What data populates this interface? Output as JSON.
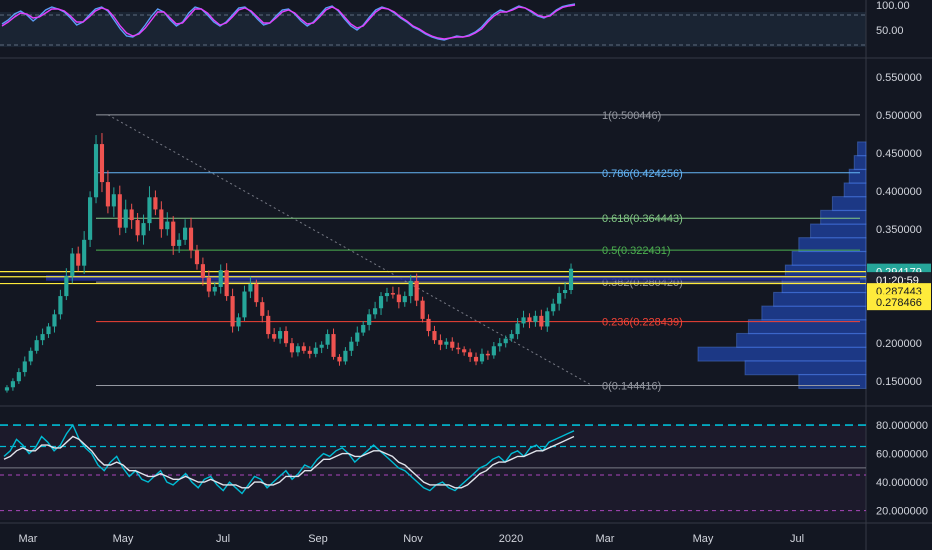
{
  "chart_data": [
    {
      "type": "line",
      "panel": "stochastic-rsi",
      "y_ticks": [
        "100.00",
        "50.00"
      ],
      "ylim": [
        0,
        110
      ],
      "series": [
        {
          "color": "#5b9cf6",
          "values": [
            62,
            70,
            82,
            88,
            80,
            68,
            78,
            90,
            96,
            92,
            86,
            74,
            60,
            66,
            80,
            92,
            96,
            88,
            70,
            52,
            38,
            36,
            44,
            60,
            78,
            92,
            86,
            70,
            58,
            66,
            84,
            96,
            92,
            80,
            66,
            58,
            66,
            80,
            94,
            96,
            86,
            72,
            60,
            64,
            78,
            90,
            92,
            82,
            68,
            58,
            66,
            80,
            94,
            98,
            88,
            72,
            58,
            50,
            60,
            76,
            90,
            96,
            92,
            84,
            74,
            66,
            56,
            50,
            42,
            36,
            32,
            30,
            34,
            38,
            36,
            40,
            46,
            56,
            70,
            82,
            90,
            86,
            92,
            98,
            94,
            86,
            78,
            74,
            80,
            90,
            97,
            100,
            102
          ]
        },
        {
          "color": "#e040fb",
          "values": [
            58,
            66,
            76,
            84,
            82,
            74,
            76,
            84,
            92,
            92,
            88,
            78,
            66,
            66,
            76,
            88,
            94,
            90,
            76,
            58,
            44,
            38,
            42,
            54,
            70,
            86,
            86,
            74,
            62,
            64,
            78,
            92,
            92,
            84,
            70,
            60,
            64,
            76,
            90,
            94,
            88,
            76,
            64,
            64,
            74,
            86,
            90,
            84,
            72,
            62,
            64,
            76,
            90,
            96,
            90,
            76,
            62,
            54,
            58,
            72,
            86,
            94,
            92,
            86,
            76,
            68,
            58,
            52,
            44,
            38,
            34,
            32,
            34,
            36,
            36,
            38,
            44,
            52,
            66,
            78,
            86,
            86,
            90,
            96,
            94,
            88,
            80,
            76,
            78,
            88,
            95,
            98,
            100
          ]
        }
      ]
    },
    {
      "type": "candlestick",
      "panel": "price",
      "x_ticks": [
        "Mar",
        "May",
        "Jul",
        "Sep",
        "Nov",
        "2020",
        "Mar",
        "May",
        "Jul"
      ],
      "y_ticks": [
        "0.550000",
        "0.500000",
        "0.450000",
        "0.400000",
        "0.350000",
        "0.300000",
        "0.250000",
        "0.200000",
        "0.150000"
      ],
      "ylim": [
        0.12,
        0.57
      ],
      "close": [
        0.142,
        0.15,
        0.162,
        0.176,
        0.19,
        0.204,
        0.212,
        0.222,
        0.238,
        0.262,
        0.288,
        0.318,
        0.302,
        0.336,
        0.392,
        0.462,
        0.412,
        0.38,
        0.396,
        0.352,
        0.376,
        0.362,
        0.342,
        0.358,
        0.392,
        0.376,
        0.35,
        0.36,
        0.328,
        0.336,
        0.352,
        0.322,
        0.304,
        0.286,
        0.268,
        0.274,
        0.296,
        0.262,
        0.222,
        0.234,
        0.268,
        0.278,
        0.254,
        0.236,
        0.212,
        0.206,
        0.216,
        0.2,
        0.188,
        0.196,
        0.19,
        0.186,
        0.194,
        0.198,
        0.212,
        0.182,
        0.176,
        0.19,
        0.202,
        0.214,
        0.224,
        0.238,
        0.246,
        0.262,
        0.266,
        0.264,
        0.254,
        0.262,
        0.282,
        0.256,
        0.232,
        0.216,
        0.204,
        0.198,
        0.202,
        0.194,
        0.192,
        0.188,
        0.182,
        0.176,
        0.186,
        0.184,
        0.196,
        0.2,
        0.206,
        0.212,
        0.226,
        0.234,
        0.228,
        0.236,
        0.222,
        0.242,
        0.252,
        0.266,
        0.27,
        0.298
      ],
      "fib_levels": [
        {
          "ratio": "1",
          "value": 0.500446,
          "label": "1(0.500446)",
          "color": "#9598a1"
        },
        {
          "ratio": "0.786",
          "value": 0.424256,
          "label": "0.786(0.424256)",
          "color": "#64b5f6"
        },
        {
          "ratio": "0.618",
          "value": 0.364443,
          "label": "0.618(0.364443)",
          "color": "#81c784"
        },
        {
          "ratio": "0.5",
          "value": 0.322431,
          "label": "0.5(0.322431)",
          "color": "#4caf50"
        },
        {
          "ratio": "0.382",
          "value": 0.28042,
          "label": "0.382(0.280420)",
          "color": "#9598a1"
        },
        {
          "ratio": "0.236",
          "value": 0.228439,
          "label": "0.236(0.228439)",
          "color": "#f44336"
        },
        {
          "ratio": "0",
          "value": 0.144416,
          "label": "0(0.144416)",
          "color": "#9598a1"
        }
      ],
      "horizontal_lines": [
        {
          "value": 0.294179,
          "color": "#ffeb3b"
        },
        {
          "value": 0.287443,
          "color": "#ffeb3b"
        },
        {
          "value": 0.278466,
          "color": "#ffeb3b"
        }
      ],
      "price_tags": [
        {
          "text": "0.294179",
          "value": 0.294179,
          "bg": "#26a69a",
          "fg": "#ffffff"
        },
        {
          "text": "01:20:59",
          "value": 0.283,
          "bg": "#1e222d",
          "fg": "#ffffff"
        },
        {
          "text": "0.287443",
          "value": 0.2685,
          "bg": "#ffeb3b",
          "fg": "#131722"
        },
        {
          "text": "0.278466",
          "value": 0.254,
          "bg": "#ffeb3b",
          "fg": "#131722"
        }
      ],
      "volume_profile": [
        {
          "value": 0.455,
          "volume": 0.05
        },
        {
          "value": 0.437,
          "volume": 0.07
        },
        {
          "value": 0.419,
          "volume": 0.1
        },
        {
          "value": 0.401,
          "volume": 0.13
        },
        {
          "value": 0.383,
          "volume": 0.2
        },
        {
          "value": 0.365,
          "volume": 0.27
        },
        {
          "value": 0.347,
          "volume": 0.33
        },
        {
          "value": 0.329,
          "volume": 0.4
        },
        {
          "value": 0.311,
          "volume": 0.44
        },
        {
          "value": 0.293,
          "volume": 0.48
        },
        {
          "value": 0.275,
          "volume": 0.5
        },
        {
          "value": 0.257,
          "volume": 0.55
        },
        {
          "value": 0.239,
          "volume": 0.62
        },
        {
          "value": 0.221,
          "volume": 0.7
        },
        {
          "value": 0.203,
          "volume": 0.77
        },
        {
          "value": 0.185,
          "volume": 1.0
        },
        {
          "value": 0.167,
          "volume": 0.72
        },
        {
          "value": 0.149,
          "volume": 0.4
        }
      ]
    },
    {
      "type": "line",
      "panel": "rsi",
      "y_ticks": [
        "80.000000",
        "60.000000",
        "40.000000",
        "20.000000"
      ],
      "ylim": [
        12,
        92
      ],
      "reference_lines": [
        80,
        65,
        50,
        45,
        20
      ],
      "series": [
        {
          "color": "#00bcd4",
          "values": [
            58,
            62,
            70,
            66,
            60,
            64,
            72,
            68,
            62,
            66,
            74,
            80,
            70,
            64,
            60,
            52,
            48,
            54,
            58,
            50,
            44,
            48,
            42,
            40,
            44,
            48,
            40,
            38,
            42,
            46,
            40,
            36,
            42,
            44,
            38,
            34,
            40,
            36,
            32,
            38,
            44,
            42,
            36,
            40,
            44,
            48,
            42,
            46,
            52,
            50,
            56,
            60,
            58,
            62,
            64,
            60,
            54,
            58,
            62,
            66,
            62,
            58,
            54,
            50,
            48,
            44,
            40,
            36,
            34,
            38,
            40,
            36,
            34,
            38,
            42,
            46,
            50,
            52,
            56,
            58,
            54,
            60,
            62,
            58,
            64,
            66,
            62,
            68,
            70,
            72,
            74,
            76
          ]
        },
        {
          "color": "#e0e3eb",
          "values": [
            56,
            58,
            62,
            64,
            62,
            62,
            66,
            66,
            64,
            64,
            68,
            72,
            70,
            66,
            62,
            56,
            52,
            52,
            54,
            52,
            48,
            48,
            46,
            44,
            44,
            46,
            44,
            42,
            42,
            44,
            42,
            40,
            40,
            42,
            40,
            38,
            38,
            38,
            36,
            36,
            40,
            40,
            38,
            38,
            40,
            44,
            44,
            44,
            48,
            48,
            52,
            56,
            56,
            58,
            60,
            60,
            58,
            58,
            60,
            62,
            62,
            60,
            58,
            54,
            52,
            48,
            44,
            40,
            38,
            38,
            38,
            38,
            36,
            36,
            38,
            42,
            46,
            48,
            52,
            54,
            54,
            56,
            58,
            58,
            60,
            62,
            62,
            64,
            66,
            68,
            70,
            72
          ]
        }
      ]
    }
  ]
}
